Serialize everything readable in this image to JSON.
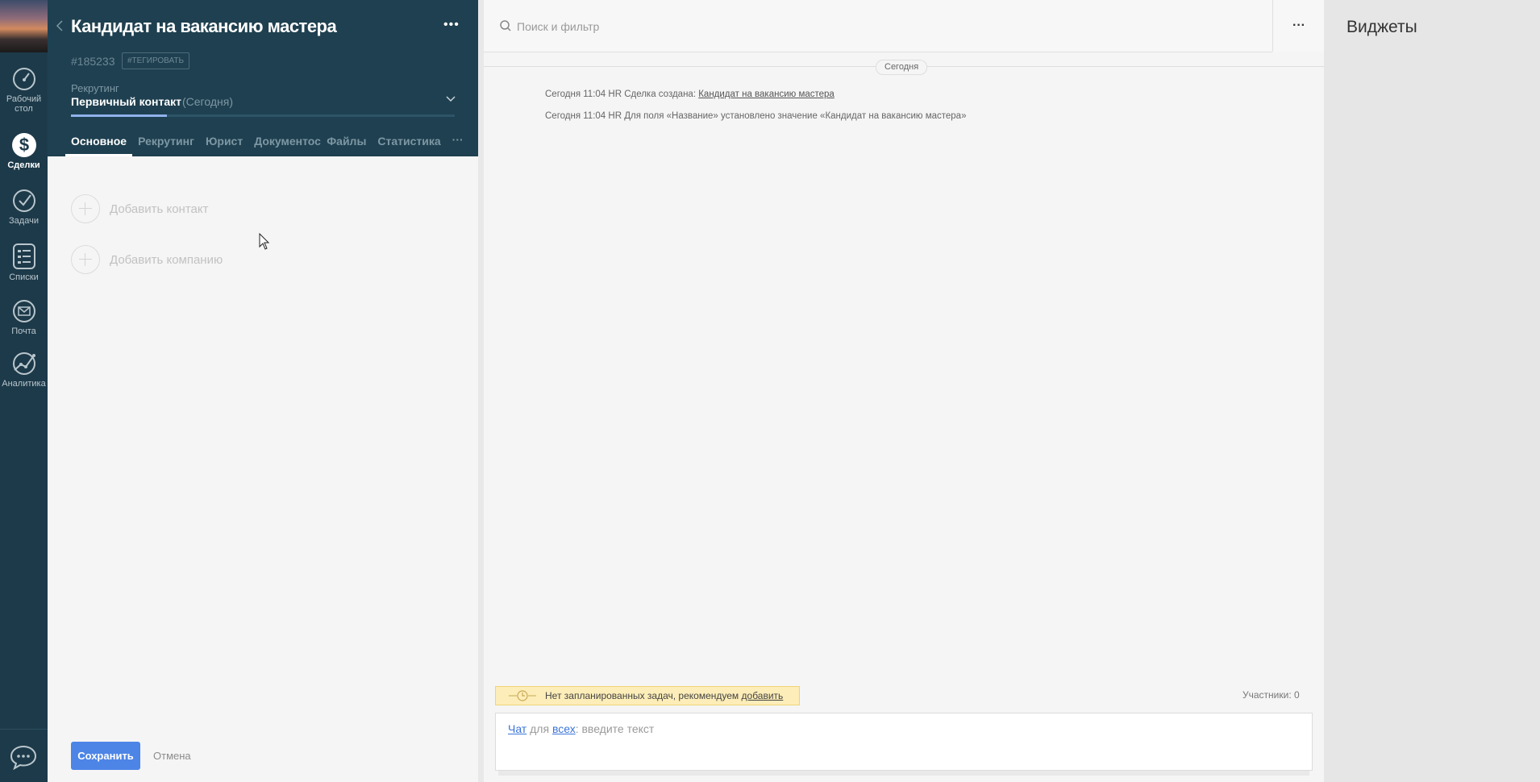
{
  "nav": {
    "items": [
      {
        "label_line1": "Рабочий",
        "label_line2": "стол",
        "icon": "speedometer-icon"
      },
      {
        "label": "Сделки",
        "icon": "dollar-icon",
        "active": true
      },
      {
        "label": "Задачи",
        "icon": "checkmark-icon"
      },
      {
        "label": "Списки",
        "icon": "list-icon"
      },
      {
        "label": "Почта",
        "icon": "mail-icon"
      },
      {
        "label": "Аналитика",
        "icon": "analytics-icon"
      }
    ]
  },
  "card": {
    "title": "Кандидат на вакансию мастера",
    "id": "#185233",
    "tag_button": "#ТЕГИРОВАТЬ",
    "pipeline": "Рекрутинг",
    "stage": "Первичный контакт",
    "stage_date": "(Сегодня)",
    "stage_progress_fraction": 0.25,
    "tabs": [
      "Основное",
      "Рекрутинг",
      "Юрист",
      "Документос",
      "Файлы",
      "Статистика"
    ],
    "tabs_more": "···",
    "add_contact": "Добавить контакт",
    "add_company": "Добавить компанию",
    "save": "Сохранить",
    "cancel": "Отмена"
  },
  "feed": {
    "search_placeholder": "Поиск и фильтр",
    "more": "···",
    "today": "Сегодня",
    "events": [
      {
        "prefix": "Сегодня 11:04 HR Сделка создана: ",
        "link": "Кандидат на вакансию мастера"
      },
      {
        "prefix": "Сегодня 11:04 HR Для поля «Название» установлено значение «Кандидат на вакансию мастера»",
        "link": ""
      }
    ],
    "notice_text": "Нет запланированных задач, рекомендуем ",
    "notice_link": "добавить",
    "members": "Участники: 0",
    "composer": {
      "chat": "Чат",
      "for": " для ",
      "all": "всех",
      "placeholder": ": введите текст"
    }
  },
  "widgets": {
    "title": "Виджеты"
  },
  "colors": {
    "nav_bg": "#1d3a4a",
    "header_bg": "#1f4050",
    "accent": "#4d85e6",
    "notice_bg": "#fdedb8"
  }
}
